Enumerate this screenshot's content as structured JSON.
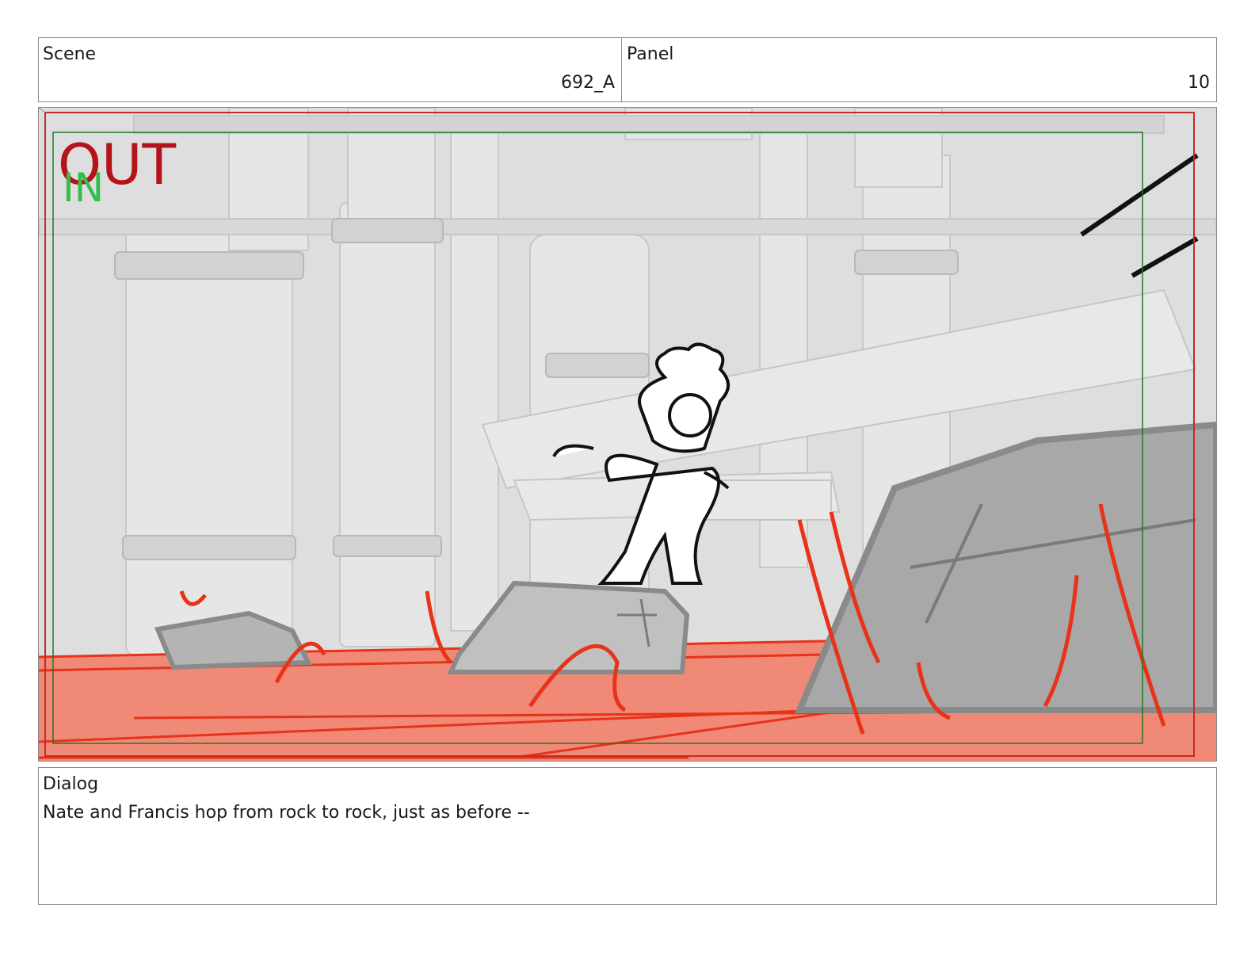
{
  "scene": {
    "label": "Scene",
    "value": "692_A"
  },
  "panel": {
    "label": "Panel",
    "value": "10"
  },
  "frame": {
    "overlay_out": "OUT",
    "overlay_in": "IN",
    "colors": {
      "out": "#b5121b",
      "in": "#2fbf4a",
      "lava": "#f08a76",
      "lava_line": "#e8321a",
      "safe_area": "#1f7a1f"
    }
  },
  "dialog": {
    "label": "Dialog",
    "text": "Nate and Francis hop from rock to rock, just as before --"
  }
}
